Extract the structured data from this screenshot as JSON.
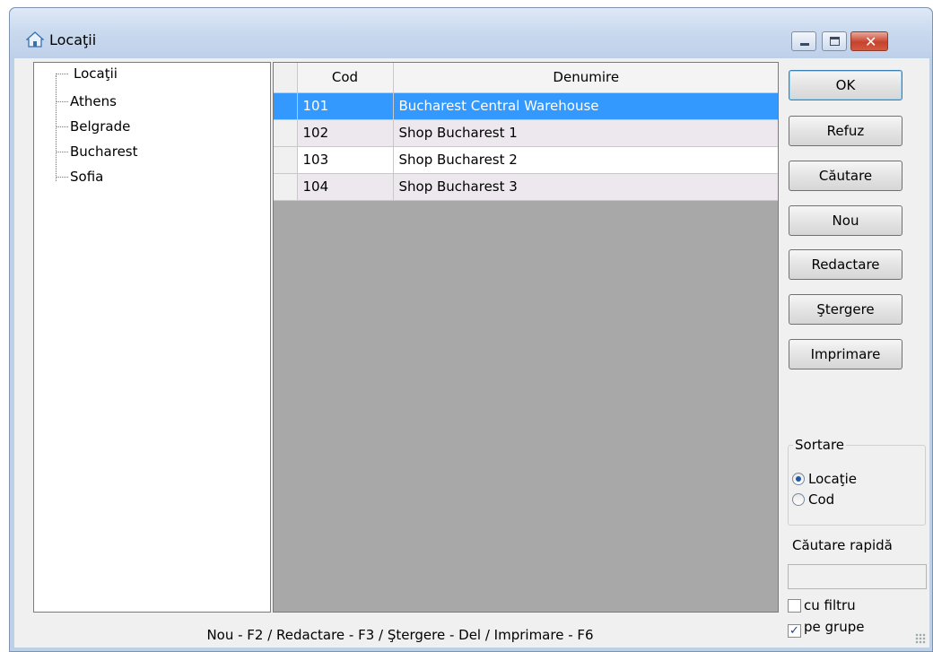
{
  "window": {
    "title": "Locaţii",
    "icon": "house-icon"
  },
  "tree": {
    "items": [
      "Locaţii",
      "Athens",
      "Belgrade",
      "Bucharest",
      "Sofia"
    ]
  },
  "grid": {
    "columns": [
      "Cod",
      "Denumire"
    ],
    "rows": [
      {
        "cod": "101",
        "denumire": "Bucharest Central Warehouse"
      },
      {
        "cod": "102",
        "denumire": "Shop Bucharest 1"
      },
      {
        "cod": "103",
        "denumire": "Shop Bucharest 2"
      },
      {
        "cod": "104",
        "denumire": "Shop Bucharest 3"
      }
    ],
    "selected_row": 0
  },
  "buttons": {
    "ok": "OK",
    "refuz": "Refuz",
    "cautare": "Căutare",
    "nou": "Nou",
    "redactare": "Redactare",
    "stergere": "Ştergere",
    "imprimare": "Imprimare"
  },
  "sort": {
    "legend": "Sortare",
    "options": [
      "Locaţie",
      "Cod"
    ],
    "selected": "Locaţie"
  },
  "quick_search": {
    "label": "Căutare rapidă",
    "value": ""
  },
  "checkboxes": {
    "cu_filtru": {
      "label": "cu filtru",
      "checked": false
    },
    "pe_grupe": {
      "label": "pe grupe",
      "checked": true
    }
  },
  "status": {
    "hint": "Nou - F2 / Redactare - F3 / Ştergere - Del / Imprimare - F6"
  },
  "colors": {
    "selection": "#3399ff",
    "grid_empty": "#a8a8a8",
    "alt_row": "#ede8ee"
  }
}
